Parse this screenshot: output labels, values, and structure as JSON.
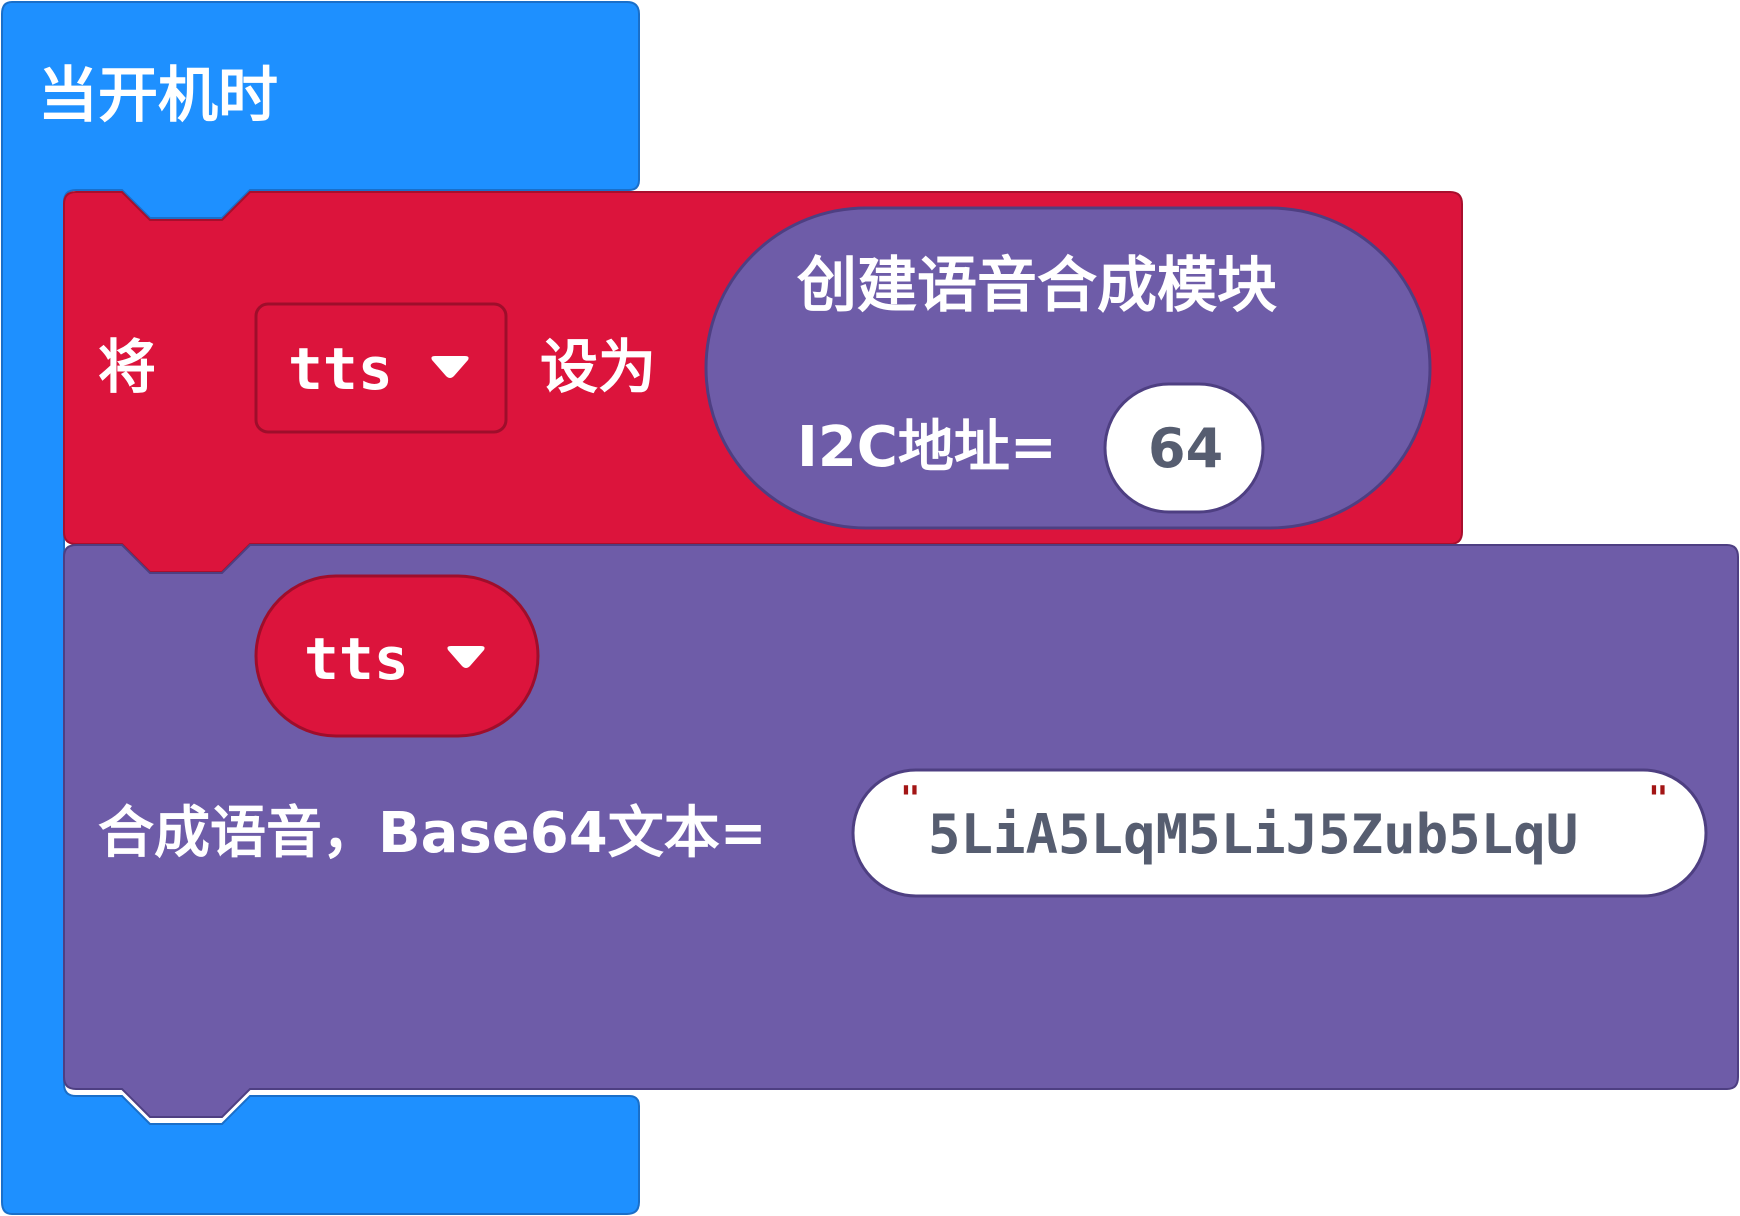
{
  "on_start": {
    "label": "当开机时",
    "color": "#1e90ff"
  },
  "set_block": {
    "label_set": "将",
    "variable": "tts",
    "label_to": "设为",
    "color": "#dc143c"
  },
  "create_block": {
    "label": "创建语音合成模块",
    "addr_label": "I2C地址=",
    "addr_value": "64",
    "color": "#6e5ca8"
  },
  "synth_block": {
    "variable": "tts",
    "label": "合成语音，Base64文本=",
    "text_value": "5LiA5LqM5LiJ5Zub5LqU",
    "quote_open": "\"",
    "quote_close": "\"",
    "color": "#6e5ca8"
  },
  "icons": {
    "dropdown": "triangle-down-icon"
  }
}
